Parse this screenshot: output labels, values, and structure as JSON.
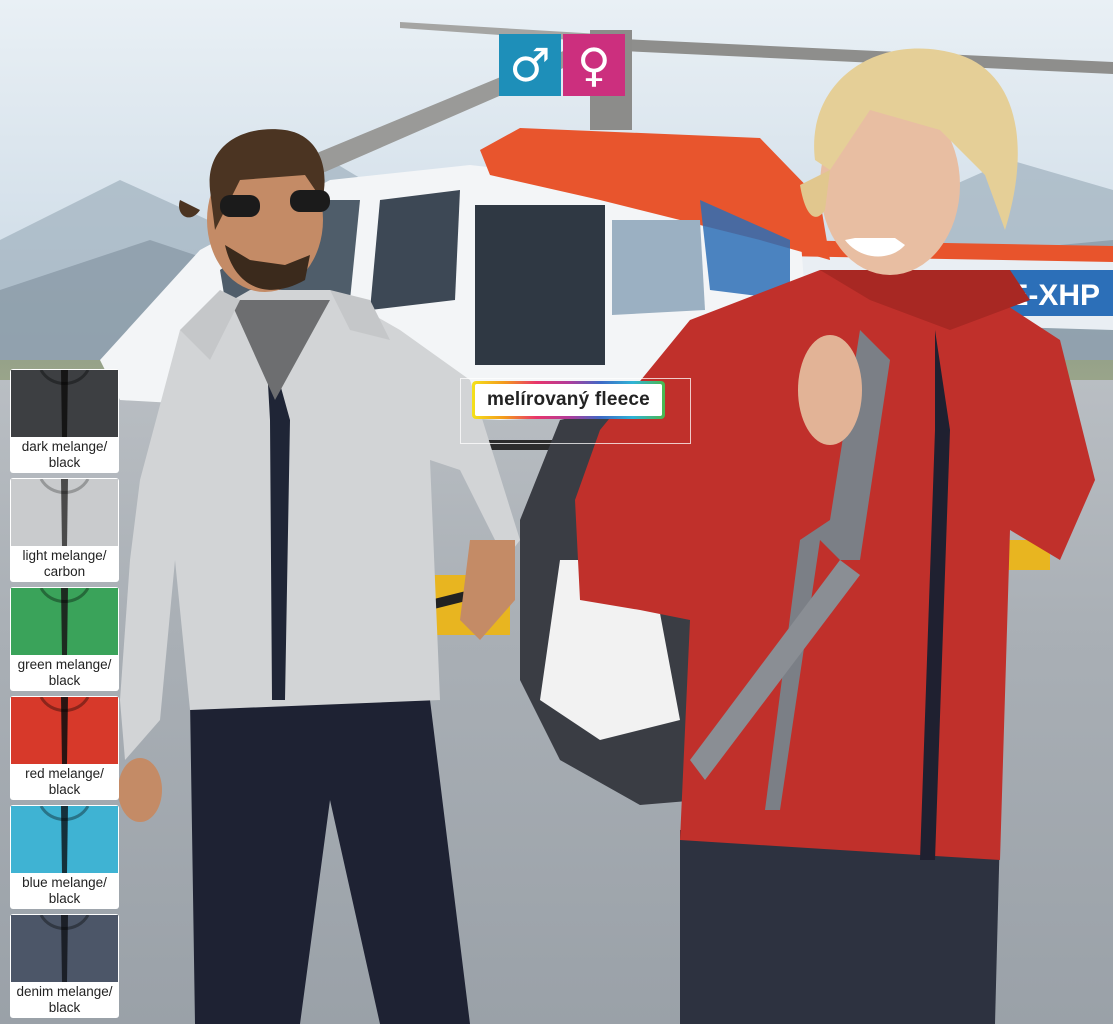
{
  "gender_icons": {
    "male": {
      "glyph": "♂",
      "icon": "male-symbol",
      "color": "#1e8fb9"
    },
    "female": {
      "glyph": "♀",
      "icon": "female-symbol",
      "color": "#cc2f7e"
    }
  },
  "badge": {
    "label": "melírovaný fleece"
  },
  "swatches": [
    {
      "line1": "dark melange/",
      "line2": "black",
      "color": "#3d3f42",
      "stripe": "#151515"
    },
    {
      "line1": "light melange/",
      "line2": "carbon",
      "color": "#c9cbcd",
      "stripe": "#4a4a4a"
    },
    {
      "line1": "green melange/",
      "line2": "black",
      "color": "#3aa35a",
      "stripe": "#1d2a20"
    },
    {
      "line1": "red melange/",
      "line2": "black",
      "color": "#d7392a",
      "stripe": "#2a1412"
    },
    {
      "line1": "blue melange/",
      "line2": "black",
      "color": "#3fb3d3",
      "stripe": "#15303a"
    },
    {
      "line1": "denim melange/",
      "line2": "black",
      "color": "#4c5668",
      "stripe": "#1b1f27"
    }
  ],
  "helicopter": {
    "registration": "OE-XHP"
  }
}
